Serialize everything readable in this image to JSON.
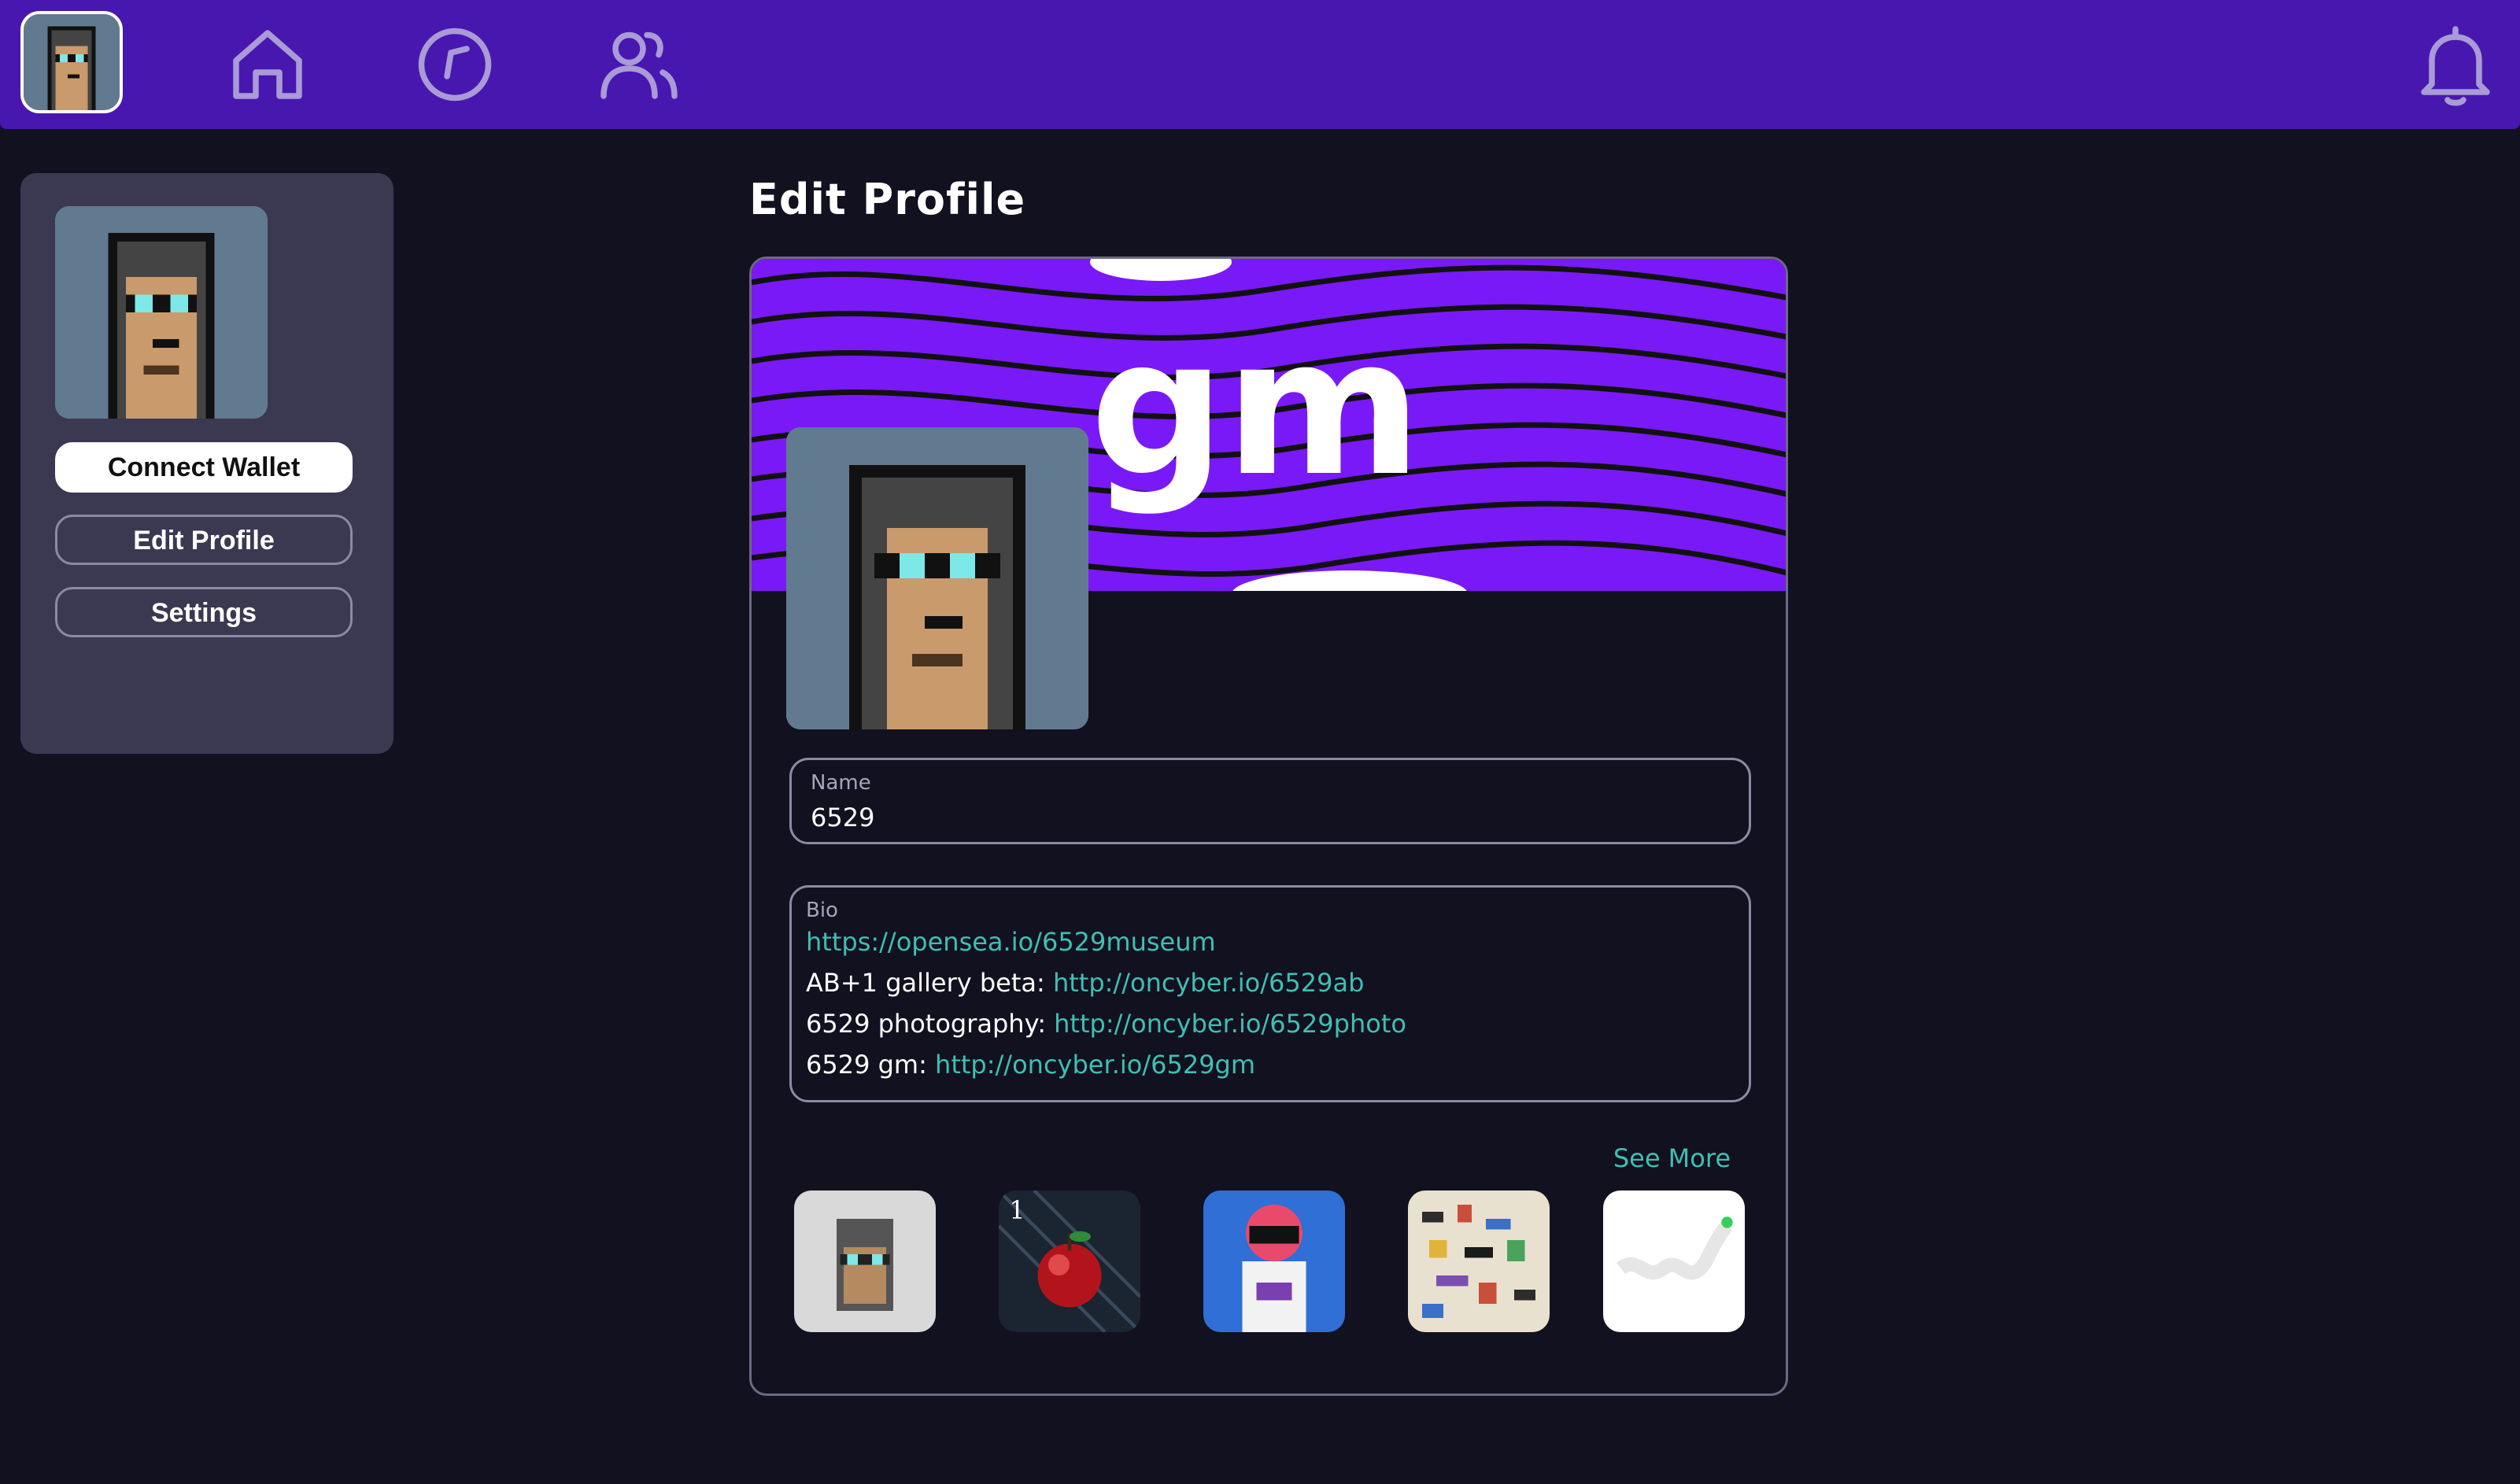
{
  "topbar": {
    "nav_icons": [
      "home-icon",
      "explore-icon",
      "users-icon"
    ],
    "right_icon": "bell-icon",
    "color": "#4817b0"
  },
  "sidebar": {
    "connect_wallet": "Connect Wallet",
    "edit_profile": "Edit Profile",
    "settings": "Settings"
  },
  "main": {
    "title": "Edit Profile",
    "banner_text": "gm",
    "name_field": {
      "label": "Name",
      "value": "6529"
    },
    "bio_field": {
      "label": "Bio",
      "lines": [
        {
          "text": "",
          "link": "https://opensea.io/6529museum"
        },
        {
          "text": "AB+1 gallery beta: ",
          "link": "http://oncyber.io/6529ab"
        },
        {
          "text": "6529 photography: ",
          "link": "http://oncyber.io/6529photo"
        },
        {
          "text": "6529 gm: ",
          "link": "http://oncyber.io/6529gm"
        }
      ]
    },
    "see_more": "See More"
  },
  "colors": {
    "background": "#12111f",
    "accent_purple": "#4817b0",
    "banner_purple": "#7a19f7",
    "link": "#3fbfb4"
  }
}
